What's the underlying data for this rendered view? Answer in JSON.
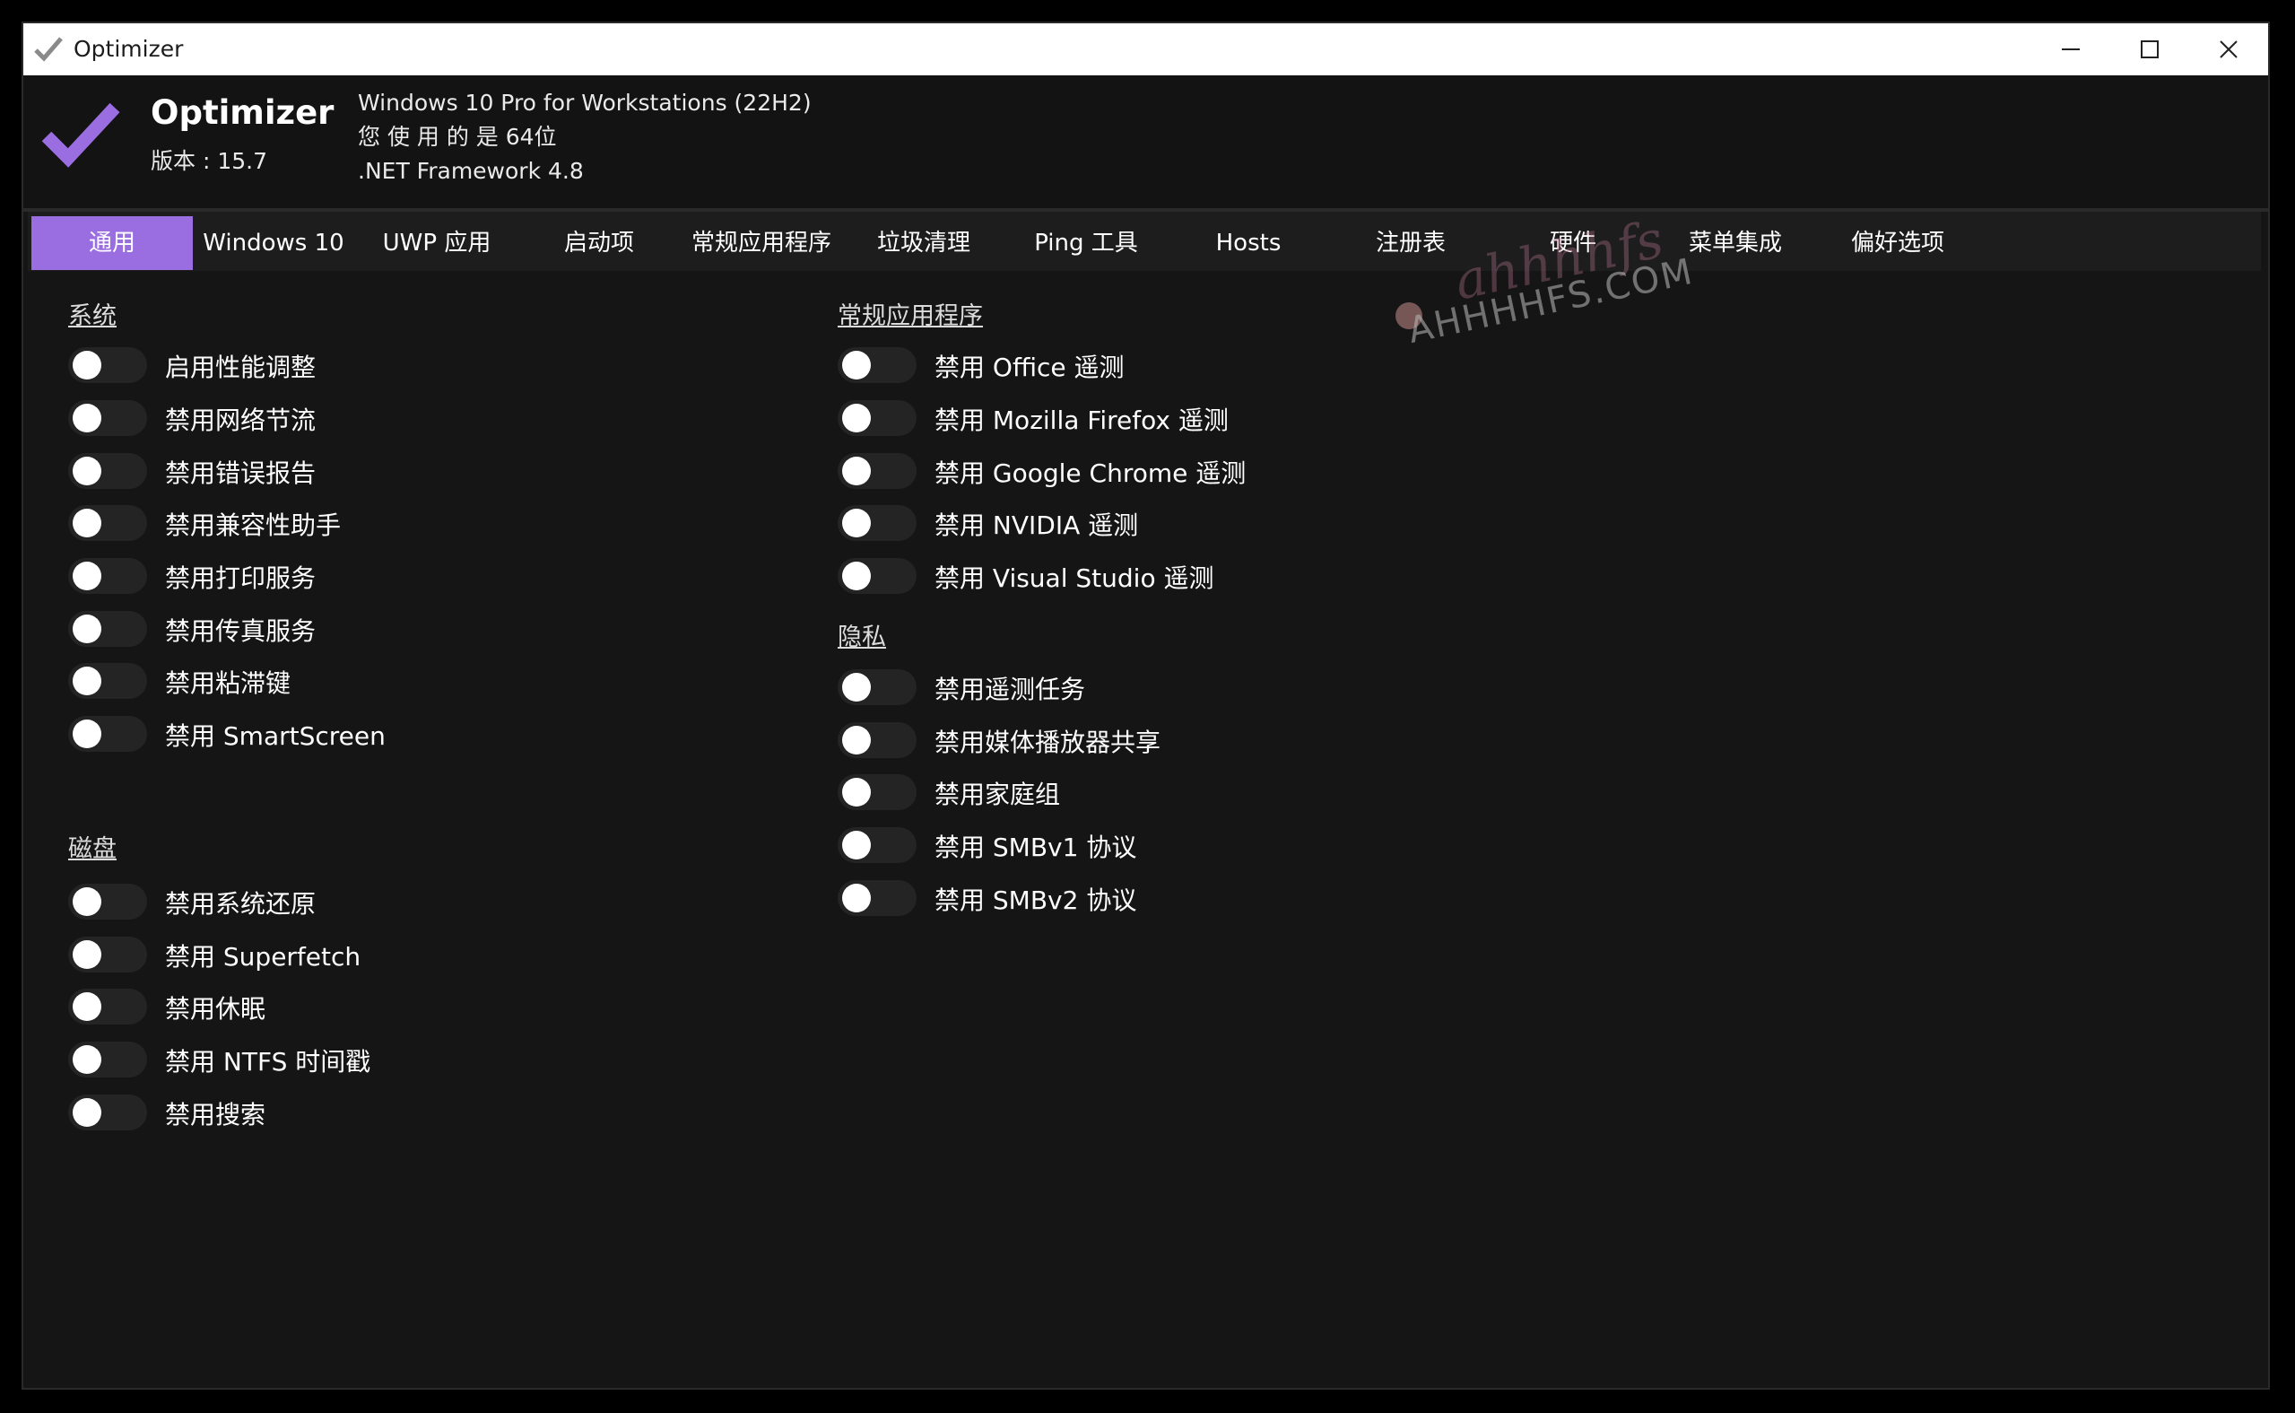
{
  "window": {
    "title": "Optimizer",
    "controls": {
      "minimize": "minimize",
      "maximize": "maximize",
      "close": "close"
    }
  },
  "header": {
    "app_name": "Optimizer",
    "version": "版本 : 15.7",
    "os": "Windows 10 Pro for Workstations (22H2)",
    "arch": "您 使 用 的 是 64位",
    "framework": ".NET Framework 4.8"
  },
  "tabs": [
    {
      "label": "通用",
      "active": true
    },
    {
      "label": "Windows 10",
      "active": false
    },
    {
      "label": "UWP 应用",
      "active": false
    },
    {
      "label": "启动项",
      "active": false
    },
    {
      "label": "常规应用程序",
      "active": false
    },
    {
      "label": "垃圾清理",
      "active": false
    },
    {
      "label": "Ping 工具",
      "active": false
    },
    {
      "label": "Hosts",
      "active": false
    },
    {
      "label": "注册表",
      "active": false
    },
    {
      "label": "硬件",
      "active": false
    },
    {
      "label": "菜单集成",
      "active": false
    },
    {
      "label": "偏好选项",
      "active": false
    }
  ],
  "sections": {
    "system": {
      "title": "系统",
      "items": [
        {
          "label": "启用性能调整",
          "on": false
        },
        {
          "label": "禁用网络节流",
          "on": false
        },
        {
          "label": "禁用错误报告",
          "on": false
        },
        {
          "label": "禁用兼容性助手",
          "on": false
        },
        {
          "label": "禁用打印服务",
          "on": false
        },
        {
          "label": "禁用传真服务",
          "on": false
        },
        {
          "label": "禁用粘滞键",
          "on": false
        },
        {
          "label": "禁用 SmartScreen",
          "on": false
        }
      ]
    },
    "disk": {
      "title": "磁盘",
      "items": [
        {
          "label": "禁用系统还原",
          "on": false
        },
        {
          "label": "禁用 Superfetch",
          "on": false
        },
        {
          "label": "禁用休眠",
          "on": false
        },
        {
          "label": "禁用 NTFS 时间戳",
          "on": false
        },
        {
          "label": "禁用搜索",
          "on": false
        }
      ]
    },
    "apps": {
      "title": "常规应用程序",
      "items": [
        {
          "label": "禁用 Office 遥测",
          "on": false
        },
        {
          "label": "禁用 Mozilla Firefox 遥测",
          "on": false
        },
        {
          "label": "禁用 Google Chrome 遥测",
          "on": false
        },
        {
          "label": "禁用 NVIDIA 遥测",
          "on": false
        },
        {
          "label": "禁用 Visual Studio 遥测",
          "on": false
        }
      ]
    },
    "privacy": {
      "title": "隐私",
      "items": [
        {
          "label": "禁用遥测任务",
          "on": false
        },
        {
          "label": "禁用媒体播放器共享",
          "on": false
        },
        {
          "label": "禁用家庭组",
          "on": false
        },
        {
          "label": "禁用 SMBv1 协议",
          "on": false
        },
        {
          "label": "禁用 SMBv2 协议",
          "on": false
        }
      ]
    }
  },
  "watermark": {
    "text": "AHHHHFS.COM",
    "script": "ahhhhfs"
  },
  "colors": {
    "accent": "#9a6ee0",
    "background": "#151515",
    "toggle_track": "#242424",
    "titlebar": "#ffffff"
  }
}
